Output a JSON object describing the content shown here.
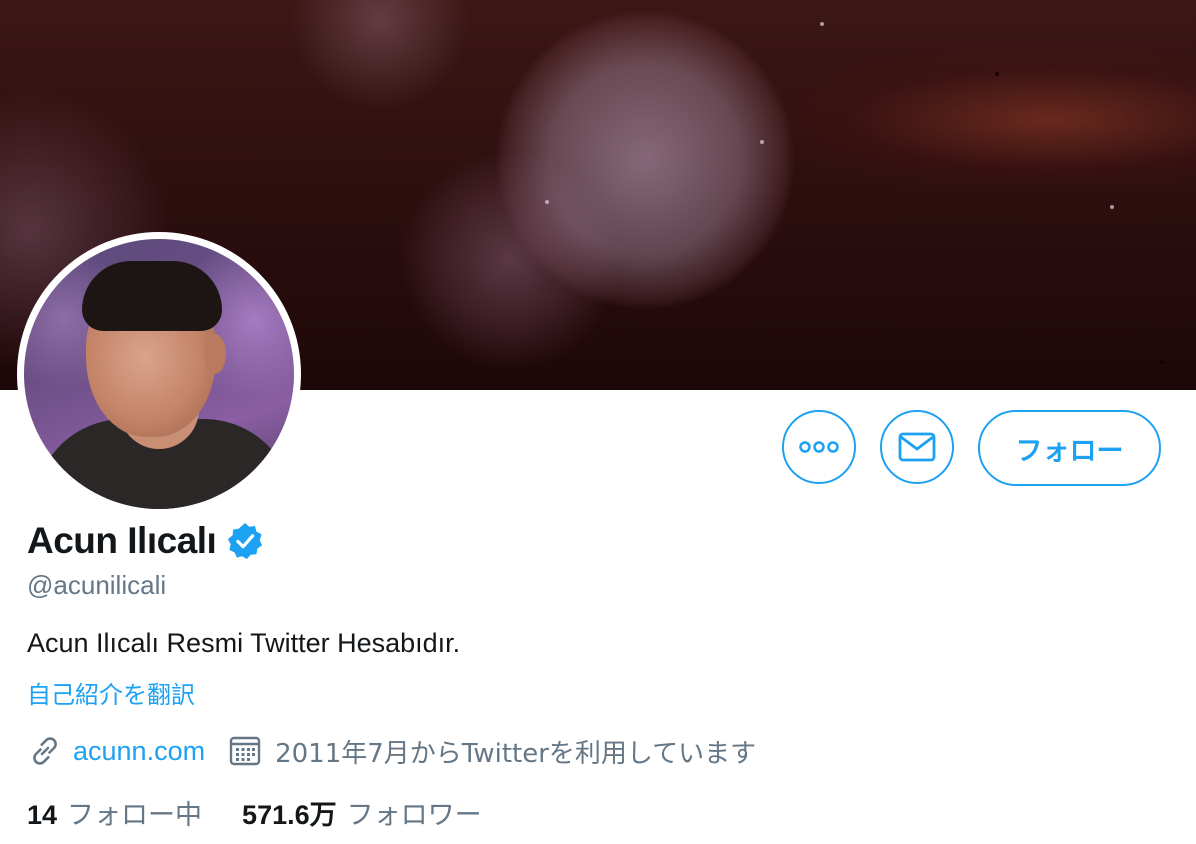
{
  "profile": {
    "name": "Acun Ilıcalı",
    "handle": "@acunilicali",
    "bio": "Acun Ilıcalı Resmi Twitter Hesabıdır.",
    "translate_label": "自己紹介を翻訳",
    "website": "acunn.com",
    "joined": "2011年7月からTwitterを利用しています",
    "following_count": "14",
    "following_label": "フォロー中",
    "followers_count": "571.6万",
    "followers_label": "フォロワー"
  },
  "actions": {
    "follow_label": "フォロー"
  },
  "icons": {
    "more": "more-icon",
    "message": "envelope-icon",
    "verified": "verified-badge-icon",
    "link": "link-icon",
    "calendar": "calendar-icon"
  },
  "colors": {
    "accent": "#1da1f2",
    "text_primary": "#14171a",
    "text_secondary": "#657786"
  }
}
